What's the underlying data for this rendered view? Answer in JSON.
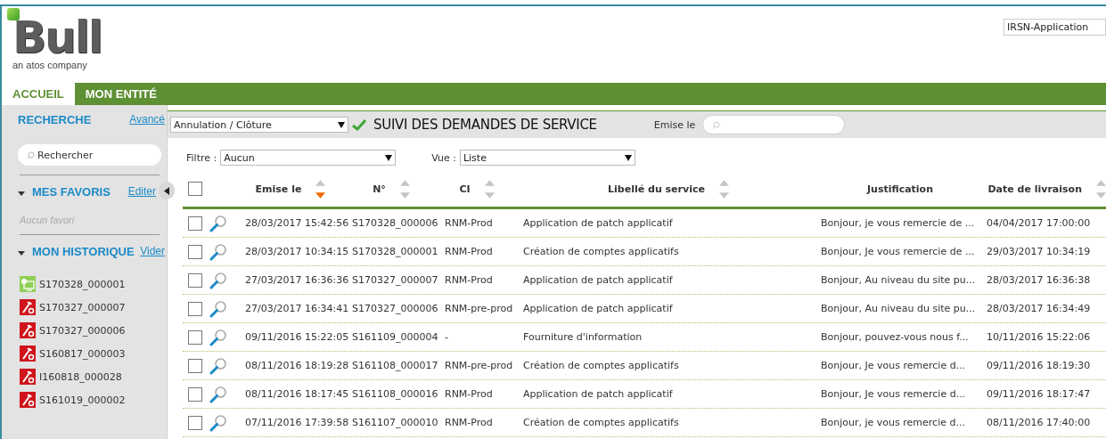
{
  "logo": {
    "name": "Bull",
    "tagline": "an atos company"
  },
  "account": {
    "value": "IRSN-Application"
  },
  "nav": [
    {
      "label": "ACCUEIL",
      "selected": true
    },
    {
      "label": "MON ENTITÉ",
      "selected": false
    }
  ],
  "sidebar": {
    "search": {
      "title": "RECHERCHE",
      "link": "Avancé",
      "placeholder": "Rechercher"
    },
    "favorites": {
      "title": "MES FAVORIS",
      "link": "Editer",
      "expanded": true,
      "empty_text": "Aucun favori"
    },
    "history": {
      "title": "MON HISTORIQUE",
      "link": "Vider",
      "expanded": true,
      "items": [
        {
          "kind": "workstation",
          "label": "S170328_000001"
        },
        {
          "kind": "repair",
          "label": "S170327_000007"
        },
        {
          "kind": "repair",
          "label": "S170327_000006"
        },
        {
          "kind": "repair",
          "label": "S160817_000003"
        },
        {
          "kind": "repair",
          "label": "I160818_000028"
        },
        {
          "kind": "repair",
          "label": "S161019_000002"
        }
      ]
    }
  },
  "toolbar": {
    "status_select": "Annulation / Clôture",
    "title": "SUIVI DES DEMANDES DE SERVICE",
    "date_label": "Emise le"
  },
  "filters": {
    "filter_label": "Filtre :",
    "filter_value": "Aucun",
    "view_label": "Vue :",
    "view_value": "Liste"
  },
  "table": {
    "header_checked": false,
    "columns": [
      {
        "label": "Emise le",
        "sortable": true,
        "sort_desc": true
      },
      {
        "label": "N°",
        "sortable": true,
        "sort_desc": false
      },
      {
        "label": "CI",
        "sortable": true,
        "sort_desc": false
      },
      {
        "label": "Libellé du service",
        "sortable": true,
        "sort_desc": false
      },
      {
        "label": "Justification",
        "sortable": false
      },
      {
        "label": "Date de livraison",
        "sortable": true,
        "sort_desc": false
      }
    ],
    "rows": [
      {
        "checked": false,
        "cells": [
          "28/03/2017 15:42:56",
          "S170328_000006",
          "RNM-Prod",
          "Application de patch applicatif",
          "Bonjour, je vous remercie de ...",
          "04/04/2017 17:00:00"
        ]
      },
      {
        "checked": false,
        "cells": [
          "28/03/2017 10:34:15",
          "S170328_000001",
          "RNM-Prod",
          "Création de comptes applicatifs",
          "Bonjour, Je vous remercie de ...",
          "29/03/2017 10:34:19"
        ]
      },
      {
        "checked": false,
        "cells": [
          "27/03/2017 16:36:36",
          "S170327_000007",
          "RNM-Prod",
          "Application de patch applicatif",
          "Bonjour, Au niveau du site pu...",
          "28/03/2017 16:36:38"
        ]
      },
      {
        "checked": false,
        "cells": [
          "27/03/2017 16:34:41",
          "S170327_000006",
          "RNM-pre-prod",
          "Application de patch applicatif",
          "Bonjour, Au niveau du site pu...",
          "28/03/2017 16:34:49"
        ]
      },
      {
        "checked": false,
        "cells": [
          "09/11/2016 15:22:05",
          "S161109_000004",
          "-",
          "Fourniture d'information",
          "Bonjour, pouvez-vous nous f...",
          "10/11/2016 15:22:06"
        ]
      },
      {
        "checked": false,
        "cells": [
          "08/11/2016 18:19:28",
          "S161108_000017",
          "RNM-pre-prod",
          "Création de comptes applicatifs",
          "Bonjour, Je vous remercie d...",
          "09/11/2016 18:19:30"
        ]
      },
      {
        "checked": false,
        "cells": [
          "08/11/2016 18:17:45",
          "S161108_000016",
          "RNM-Prod",
          "Application de patch applicatif",
          "Bonjour, Je vous remercie d...",
          "09/11/2016 18:17:47"
        ]
      },
      {
        "checked": false,
        "cells": [
          "07/11/2016 17:39:58",
          "S161107_000010",
          "RNM-Prod",
          "Création de comptes applicatifs",
          "Bonjour, je vous remercie d...",
          "08/11/2016 17:40:00"
        ]
      }
    ]
  }
}
